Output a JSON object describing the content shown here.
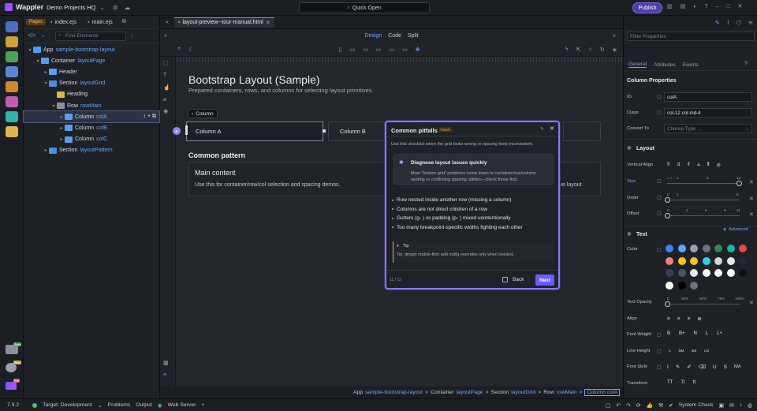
{
  "app": {
    "name": "Wappler",
    "project": "Demo Projects HQ",
    "quick_open": "Quick Open",
    "publish": "Publish"
  },
  "left": {
    "tab_pages": "Pages",
    "file1": "index.ejs",
    "file2": "main.ejs",
    "filter_placeholder": "Find Elements",
    "tree": [
      {
        "label": "App",
        "name": "sample-bootstrap-layout",
        "depth": 0,
        "caret": "▾",
        "color": "#3ea0ff"
      },
      {
        "label": "Container",
        "name": "layoutPage",
        "depth": 1,
        "caret": "▾",
        "color": "#5a9cf0"
      },
      {
        "label": "Header",
        "name": "",
        "depth": 2,
        "caret": "▸",
        "color": "#5a9cf0"
      },
      {
        "label": "Section",
        "name": "layoutGrid",
        "depth": 2,
        "caret": "▾",
        "color": "#4a8fe0"
      },
      {
        "label": "Heading",
        "name": "",
        "depth": 3,
        "caret": "",
        "color": "#e0b64a"
      },
      {
        "label": "Row",
        "name": "rowMain",
        "depth": 3,
        "caret": "▾",
        "color": "#8a90a0"
      },
      {
        "label": "Column",
        "name": "colA",
        "depth": 4,
        "caret": "▸",
        "color": "#5a9cf0",
        "selected": true
      },
      {
        "label": "Column",
        "name": "colB",
        "depth": 4,
        "caret": "▸",
        "color": "#5a9cf0"
      },
      {
        "label": "Column",
        "name": "colC",
        "depth": 4,
        "caret": "▸",
        "color": "#5a9cf0"
      },
      {
        "label": "Section",
        "name": "layoutPattern",
        "depth": 2,
        "caret": "▸",
        "color": "#4a8fe0"
      }
    ]
  },
  "editor": {
    "tab": "layout-preview--tour-manual.html",
    "modes": [
      "Design",
      "Code",
      "Split"
    ],
    "active_mode": "Design"
  },
  "canvas": {
    "title": "Bootstrap Layout (Sample)",
    "subtitle": "Prepared containers, rows, and columns for selecting layout primitives.",
    "crumb": "Column",
    "colA": "Column A",
    "colB": "Column B",
    "section2": "Common pattern",
    "card_title": "Main content",
    "card_desc": "Use this for container/row/col selection and spacing demos.",
    "card_right": "ive layout"
  },
  "breadcrumb": {
    "app": "App",
    "app_name": "sample-bootstrap-layout",
    "container": "Container",
    "container_name": "layoutPage",
    "section": "Section",
    "section_name": "layoutGrid",
    "row": "Row",
    "row_name": "rowMain",
    "col": "Column colA",
    "sep": ">"
  },
  "popover": {
    "title": "Common pitfalls",
    "badge": "TOUR",
    "subtitle": "Use this checklist when the grid looks wrong or spacing feels inconsistent.",
    "card_title": "Diagnose layout issues quickly",
    "card_desc": "Most \"broken grid\" problems come down to container/row/column nesting or conflicting spacing utilities—check those first.",
    "items": [
      "Row nested inside another row (missing a column)",
      "Columns are not direct children of a row",
      "Gutters (g-  ) vs padding (p-  ) mixed unintentionally",
      "Too many breakpoint-specific widths fighting each other"
    ],
    "tip_label": "Tip",
    "tip_text": "Tip: design mobile-first; add md/lg overrides only when needed.",
    "page": "11 / 12",
    "back": "Back",
    "next": "Next"
  },
  "right": {
    "filter_placeholder": "Filter Properties",
    "tabs": [
      "General",
      "Attributes",
      "Events"
    ],
    "section": "Column Properties",
    "id_label": "ID",
    "id_value": "colA",
    "class_label": "Class",
    "class_value": "col-12 col-md-4",
    "convert_label": "Convert To",
    "convert_placeholder": "Choose Type ...",
    "layout": "Layout",
    "valign": "Vertical Align",
    "size": "Size",
    "order": "Order",
    "offset": "Offset",
    "size_ticks": [
      "1",
      "6",
      "12"
    ],
    "size_extra": "= =",
    "order_ticks": [
      "0",
      "1",
      "5"
    ],
    "offset_ticks": [
      "0",
      "3",
      "6",
      "9",
      "11"
    ],
    "text": "Text",
    "advanced": "Advanced",
    "color": "Color",
    "text_opacity": "Text Opacity",
    "opacity_ticks": [
      "0",
      "25%",
      "50%",
      "75%",
      "100%"
    ],
    "align": "Align",
    "font_weight": "Font Weight",
    "fw": [
      "B",
      "B+",
      "N",
      "L",
      "L+"
    ],
    "line_height": "Line Height",
    "lh": [
      "1",
      "SM",
      "BS",
      "LG"
    ],
    "font_style": "Font Style",
    "fs_na": "N/A",
    "transform": "Transform",
    "tr": [
      "TT",
      "Tt",
      "tt"
    ],
    "colors": [
      "#3b82f6",
      "#60a5fa",
      "#9ca3af",
      "#6b7280",
      "#2e8b57",
      "#14b8a6",
      "#ef4444",
      "#f08080",
      "#f5c518",
      "#fbbf24",
      "#22d3ee",
      "#d1d5db",
      "#e5e7eb",
      "#1f2937",
      "#374151",
      "#4b5563",
      "#e5e7eb",
      "#f3f4f6",
      "#ffffff",
      "#ffffff",
      "#111111",
      "#ffffff",
      "#000000",
      "#6b7280"
    ]
  },
  "status": {
    "version": "7.9.2",
    "target": "Target: Development",
    "problems": "Problems",
    "output": "Output",
    "web": "Web Server",
    "system": "System Check"
  },
  "badges": {
    "beta": "Beta",
    "pro": "Pro"
  }
}
